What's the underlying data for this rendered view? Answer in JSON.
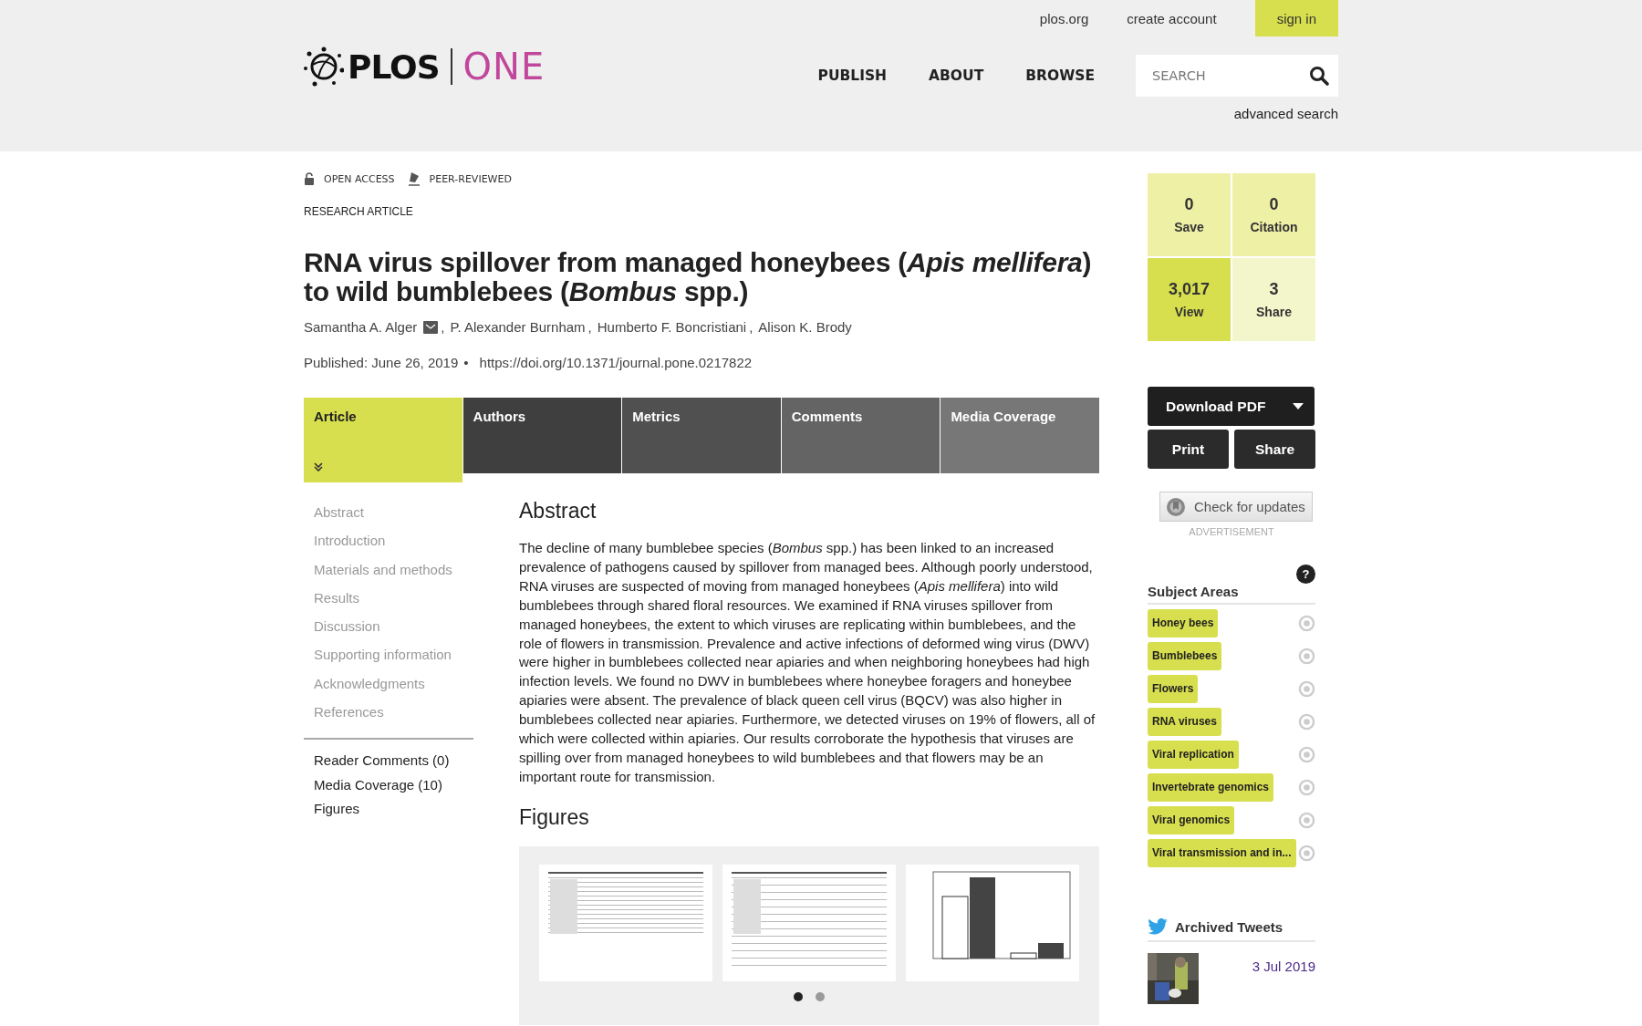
{
  "header": {
    "logo": {
      "brand": "PLOS",
      "journal": "ONE"
    },
    "top_links": [
      "plos.org",
      "create account"
    ],
    "sign_in": "sign in",
    "nav": [
      "PUBLISH",
      "ABOUT",
      "BROWSE"
    ],
    "search": {
      "placeholder": "SEARCH"
    },
    "advanced_search": "advanced search"
  },
  "badges": [
    {
      "kind": "open",
      "label": "OPEN ACCESS"
    },
    {
      "kind": "peer",
      "label": "PEER-REVIEWED"
    }
  ],
  "article_type": "RESEARCH ARTICLE",
  "title": "RNA virus spillover from managed honeybees (*Apis mellifera*) to wild bumblebees (*Bombus* spp.)",
  "authors": [
    {
      "name": "Samantha A. Alger",
      "email": true
    },
    {
      "name": "P. Alexander Burnham",
      "email": false
    },
    {
      "name": "Humberto F. Boncristiani",
      "email": false
    },
    {
      "name": "Alison K. Brody",
      "email": false
    }
  ],
  "author_separator": ",",
  "published": "Published: June 26, 2019",
  "published_bullet": "•",
  "doi": "https://doi.org/10.1371/journal.pone.0217822",
  "tabs": [
    {
      "label": "Article",
      "selected": true,
      "color": "#d8df4e"
    },
    {
      "label": "Authors",
      "selected": false,
      "color": "#3f3f3f"
    },
    {
      "label": "Metrics",
      "selected": false,
      "color": "#505050"
    },
    {
      "label": "Comments",
      "selected": false,
      "color": "#646464"
    },
    {
      "label": "Media Coverage",
      "selected": false,
      "color": "#777777"
    }
  ],
  "toc": [
    "Abstract",
    "Introduction",
    "Materials and methods",
    "Results",
    "Discussion",
    "Supporting information",
    "Acknowledgments",
    "References"
  ],
  "extra_links": [
    "Reader Comments (0)",
    "Media Coverage (10)",
    "Figures"
  ],
  "abstract": {
    "heading": "Abstract",
    "text": "The decline of many bumblebee species (*Bombus* spp.) has been linked to an increased prevalence of pathogens caused by spillover from managed bees. Although poorly understood, RNA viruses are suspected of moving from managed honeybees (*Apis mellifera*) into wild bumblebees through shared floral resources. We examined if RNA viruses spillover from managed honeybees, the extent to which viruses are replicating within bumblebees, and the role of flowers in transmission. Prevalence and active infections of deformed wing virus (DWV) were higher in bumblebees collected near apiaries and when neighboring honeybees had high infection levels. We found no DWV in bumblebees where honeybee foragers and honeybee apiaries were absent. The prevalence of black queen cell virus (BQCV) was also higher in bumblebees collected near apiaries. Furthermore, we detected viruses on 19% of flowers, all of which were collected within apiaries. Our results corroborate the hypothesis that viruses are spilling over from managed honeybees to wild bumblebees and that flowers may be an important route for transmission."
  },
  "figures": {
    "heading": "Figures",
    "thumbnails": [
      {
        "kind": "table"
      },
      {
        "kind": "table"
      },
      {
        "kind": "chart"
      }
    ],
    "dots": [
      {
        "selected": true
      },
      {
        "selected": false
      }
    ]
  },
  "metrics": [
    {
      "value": "0",
      "label": "Save",
      "color": "#eef0a6"
    },
    {
      "value": "0",
      "label": "Citation",
      "color": "#eef0a6"
    },
    {
      "value": "3,017",
      "label": "View",
      "color": "#d8df4e"
    },
    {
      "value": "3",
      "label": "Share",
      "color": "#f3f5cb"
    }
  ],
  "download_pdf": "Download PDF",
  "actions": [
    "Print",
    "Share"
  ],
  "check_updates": "Check for updates",
  "advertisement": "ADVERTISEMENT",
  "subject_areas": {
    "help": "?",
    "heading": "Subject Areas",
    "items": [
      "Honey bees",
      "Bumblebees",
      "Flowers",
      "RNA viruses",
      "Viral replication",
      "Invertebrate genomics",
      "Viral genomics",
      "Viral transmission and in..."
    ]
  },
  "tweets": {
    "heading": "Archived Tweets",
    "date": "3 Jul 2019"
  }
}
